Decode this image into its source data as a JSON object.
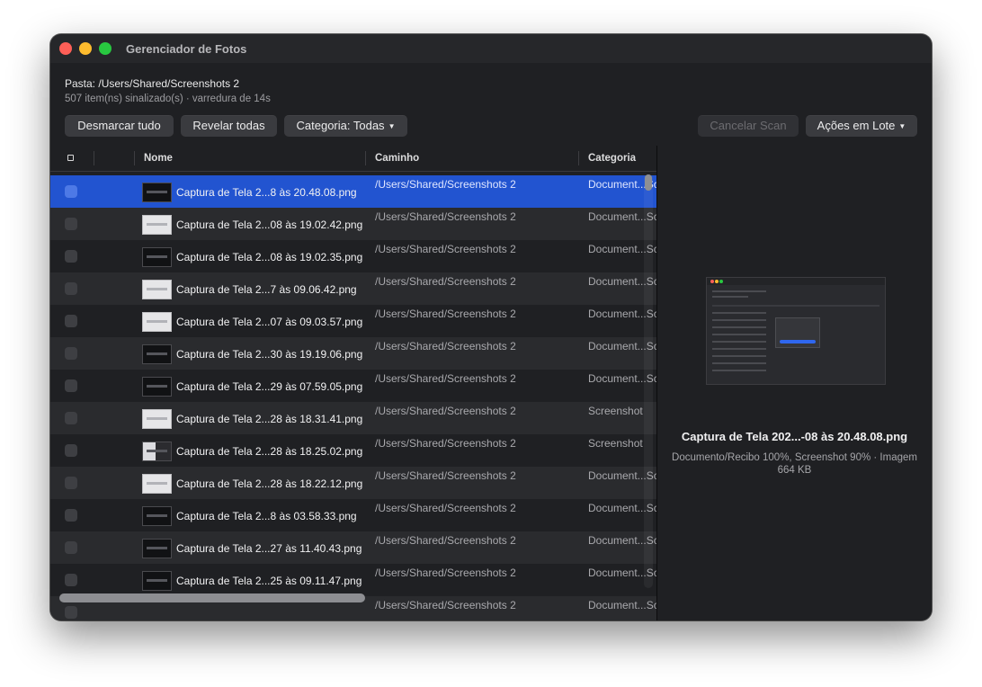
{
  "window": {
    "title": "Gerenciador de Fotos"
  },
  "info": {
    "folder": "Pasta: /Users/Shared/Screenshots 2",
    "status": "507 item(ns) sinalizado(s) · varredura de 14s"
  },
  "toolbar": {
    "unselect_all": "Desmarcar tudo",
    "reveal_all": "Revelar todas",
    "category": "Categoria: Todas",
    "cancel_scan": "Cancelar Scan",
    "batch_actions": "Ações em Lote"
  },
  "table": {
    "columns": {
      "name": "Nome",
      "path": "Caminho",
      "category": "Categoria"
    },
    "rows": [
      {
        "name": "Captura de Tela 2...8 às 20.48.08.png",
        "path": "/Users/Shared/Screenshots 2",
        "category": "Document...Sc",
        "thumb": "dark",
        "selected": true
      },
      {
        "name": "Captura de Tela 2...08 às 19.02.42.png",
        "path": "/Users/Shared/Screenshots 2",
        "category": "Document...Sc",
        "thumb": "light"
      },
      {
        "name": "Captura de Tela 2...08 às 19.02.35.png",
        "path": "/Users/Shared/Screenshots 2",
        "category": "Document...Sc",
        "thumb": "dark"
      },
      {
        "name": "Captura de Tela 2...7 às 09.06.42.png",
        "path": "/Users/Shared/Screenshots 2",
        "category": "Document...Sc",
        "thumb": "light"
      },
      {
        "name": "Captura de Tela 2...07 às 09.03.57.png",
        "path": "/Users/Shared/Screenshots 2",
        "category": "Document...Sc",
        "thumb": "light"
      },
      {
        "name": "Captura de Tela 2...30 às 19.19.06.png",
        "path": "/Users/Shared/Screenshots 2",
        "category": "Document...Sc",
        "thumb": "dark"
      },
      {
        "name": "Captura de Tela 2...29 às 07.59.05.png",
        "path": "/Users/Shared/Screenshots 2",
        "category": "Document...Sc",
        "thumb": "dark"
      },
      {
        "name": "Captura de Tela 2...28 às 18.31.41.png",
        "path": "/Users/Shared/Screenshots 2",
        "category": "Screenshot",
        "thumb": "light"
      },
      {
        "name": "Captura de Tela 2...28 às 18.25.02.png",
        "path": "/Users/Shared/Screenshots 2",
        "category": "Screenshot",
        "thumb": "mixed"
      },
      {
        "name": "Captura de Tela 2...28 às 18.22.12.png",
        "path": "/Users/Shared/Screenshots 2",
        "category": "Document...Sc",
        "thumb": "light"
      },
      {
        "name": "Captura de Tela 2...8 às 03.58.33.png",
        "path": "/Users/Shared/Screenshots 2",
        "category": "Document...Sc",
        "thumb": "dark"
      },
      {
        "name": "Captura de Tela 2...27 às 11.40.43.png",
        "path": "/Users/Shared/Screenshots 2",
        "category": "Document...Sc",
        "thumb": "dark"
      },
      {
        "name": "Captura de Tela 2...25 às 09.11.47.png",
        "path": "/Users/Shared/Screenshots 2",
        "category": "Document...Sc",
        "thumb": "dark"
      },
      {
        "name": "",
        "path": "/Users/Shared/Screenshots 2",
        "category": "Document...Sc",
        "thumb": "none"
      }
    ]
  },
  "preview": {
    "title": "Captura de Tela 202...-08 às 20.48.08.png",
    "meta": "Documento/Recibo 100%, Screenshot 90% · Imagem 664 KB"
  },
  "colors": {
    "selection": "#2254d0",
    "window_bg": "#1f2023",
    "row_alt": "#2a2b2e"
  },
  "icons": {
    "close": "close-icon",
    "minimize": "minimize-icon",
    "maximize": "maximize-icon",
    "caret": "chevron-down-icon",
    "checkbox": "checkbox-icon"
  }
}
